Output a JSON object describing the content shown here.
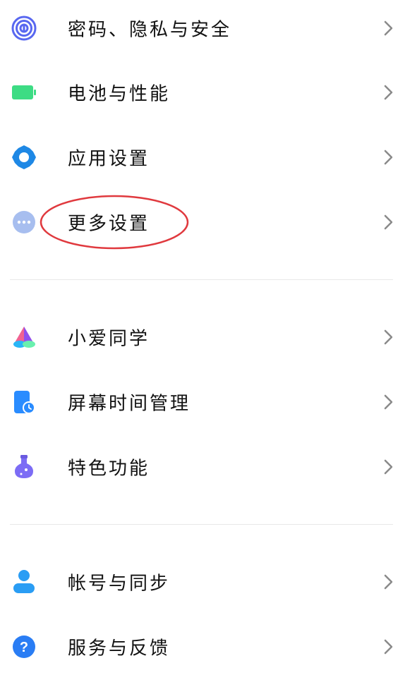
{
  "settings": {
    "group1": [
      {
        "label": "密码、隐私与安全",
        "icon": "fingerprint-icon",
        "color": "#5867F0"
      },
      {
        "label": "电池与性能",
        "icon": "battery-icon",
        "color": "#3DDC84"
      },
      {
        "label": "应用设置",
        "icon": "gear-icon",
        "color": "#1E88E5"
      },
      {
        "label": "更多设置",
        "icon": "more-dots-icon",
        "color": "#A7BEEF"
      }
    ],
    "group2": [
      {
        "label": "小爱同学",
        "icon": "xiaoai-icon",
        "color": "#7C4DFF"
      },
      {
        "label": "屏幕时间管理",
        "icon": "screen-time-icon",
        "color": "#2A8CFF"
      },
      {
        "label": "特色功能",
        "icon": "flask-icon",
        "color": "#7C6CF5"
      }
    ],
    "group3": [
      {
        "label": "帐号与同步",
        "icon": "account-icon",
        "color": "#2A9DF4"
      },
      {
        "label": "服务与反馈",
        "icon": "help-icon",
        "color": "#2A7DF4"
      }
    ]
  },
  "annotation": {
    "target": "更多设置",
    "color": "#E0393E"
  }
}
